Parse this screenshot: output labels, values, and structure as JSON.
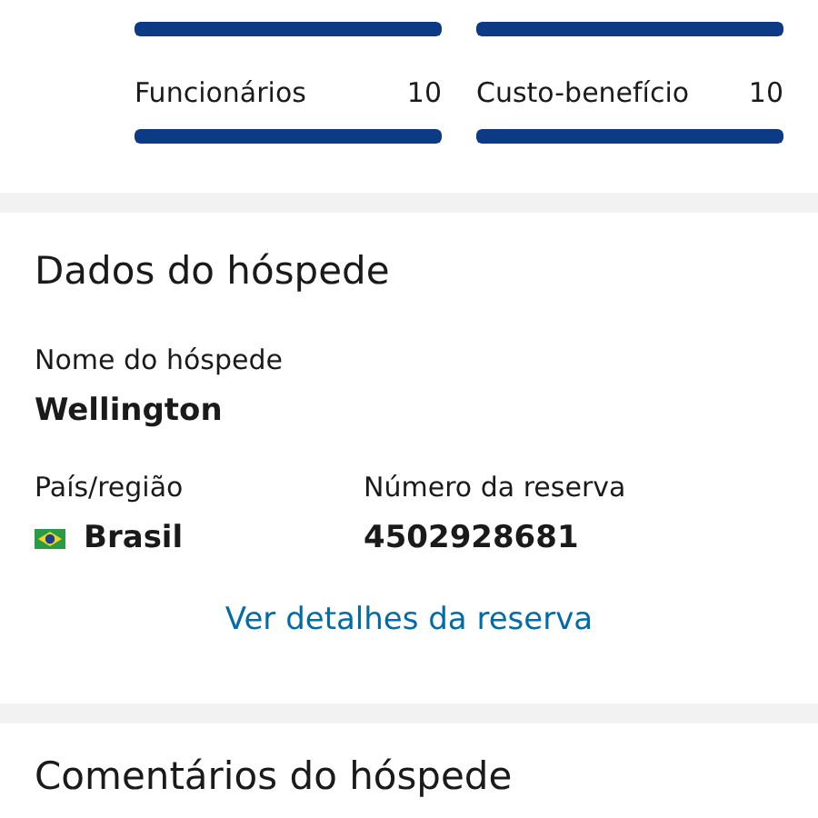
{
  "ratings": [
    {
      "level": 1
    },
    {
      "level": 1
    },
    {
      "label": "Funcionários",
      "score": "10",
      "level": 1
    },
    {
      "label": "Custo-benefício",
      "score": "10",
      "level": 1
    }
  ],
  "guest_data": {
    "title": "Dados do hóspede",
    "name_label": "Nome do hóspede",
    "name": "Wellington",
    "country_label": "País/região",
    "country": "Brasil",
    "booking_label": "Número da reserva",
    "booking_number": "4502928681",
    "link": "Ver detalhes da reserva"
  },
  "guest_comments": {
    "title": "Comentários do hóspede"
  }
}
